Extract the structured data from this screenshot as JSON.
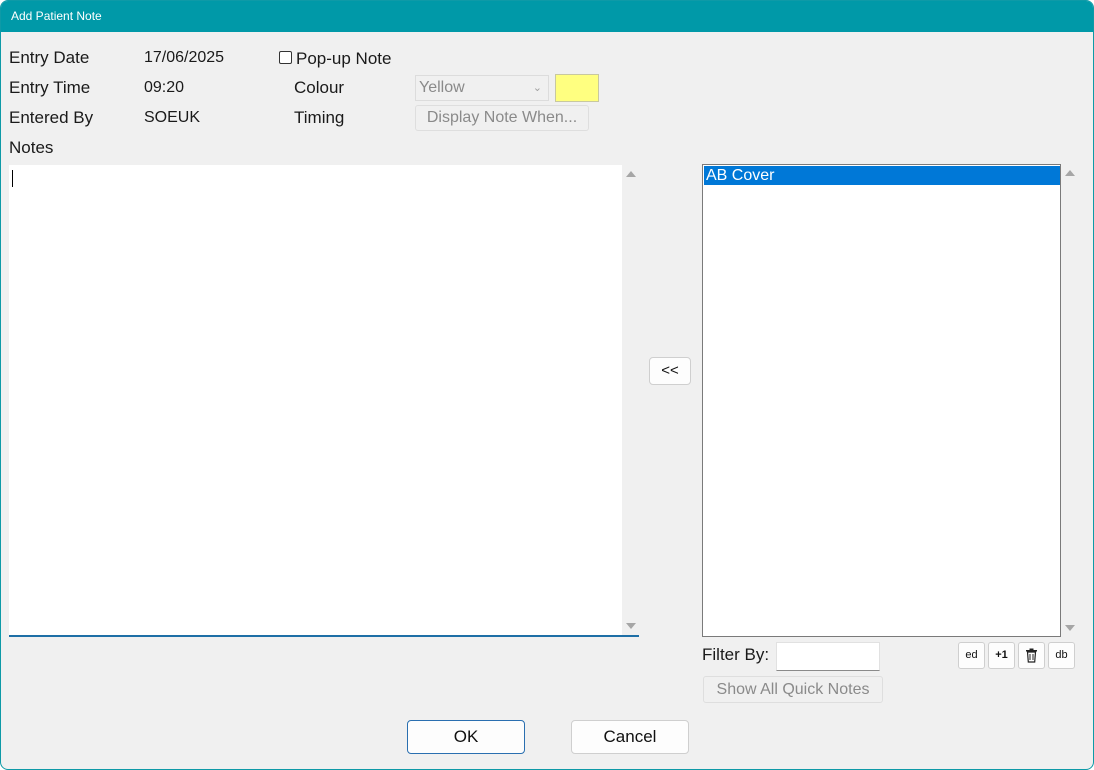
{
  "window": {
    "title": "Add Patient Note"
  },
  "fields": {
    "entry_date_label": "Entry Date",
    "entry_date_value": "17/06/2025",
    "entry_time_label": "Entry Time",
    "entry_time_value": "09:20",
    "entered_by_label": "Entered By",
    "entered_by_value": "SOEUK",
    "popup_note_label": "Pop-up Note",
    "popup_note_checked": false,
    "colour_label": "Colour",
    "colour_value": "Yellow",
    "colour_swatch": "#ffff80",
    "timing_label": "Timing",
    "display_note_when_label": "Display Note When...",
    "notes_label": "Notes",
    "notes_value": ""
  },
  "quick_notes": {
    "transfer_label": "<<",
    "items": [
      "AB Cover"
    ],
    "selected_index": 0,
    "filter_label": "Filter By:",
    "filter_value": "",
    "show_all_label": "Show All Quick Notes",
    "tools": [
      {
        "icon": "edit-icon",
        "label": "ed"
      },
      {
        "icon": "add-one-icon",
        "label": "+1"
      },
      {
        "icon": "trash-icon",
        "label": ""
      },
      {
        "icon": "database-icon",
        "label": "db"
      }
    ]
  },
  "actions": {
    "ok_label": "OK",
    "cancel_label": "Cancel"
  },
  "colors": {
    "title_bar": "#0099a8",
    "selection": "#0078d7",
    "focus_underline": "#1e6fa6"
  }
}
